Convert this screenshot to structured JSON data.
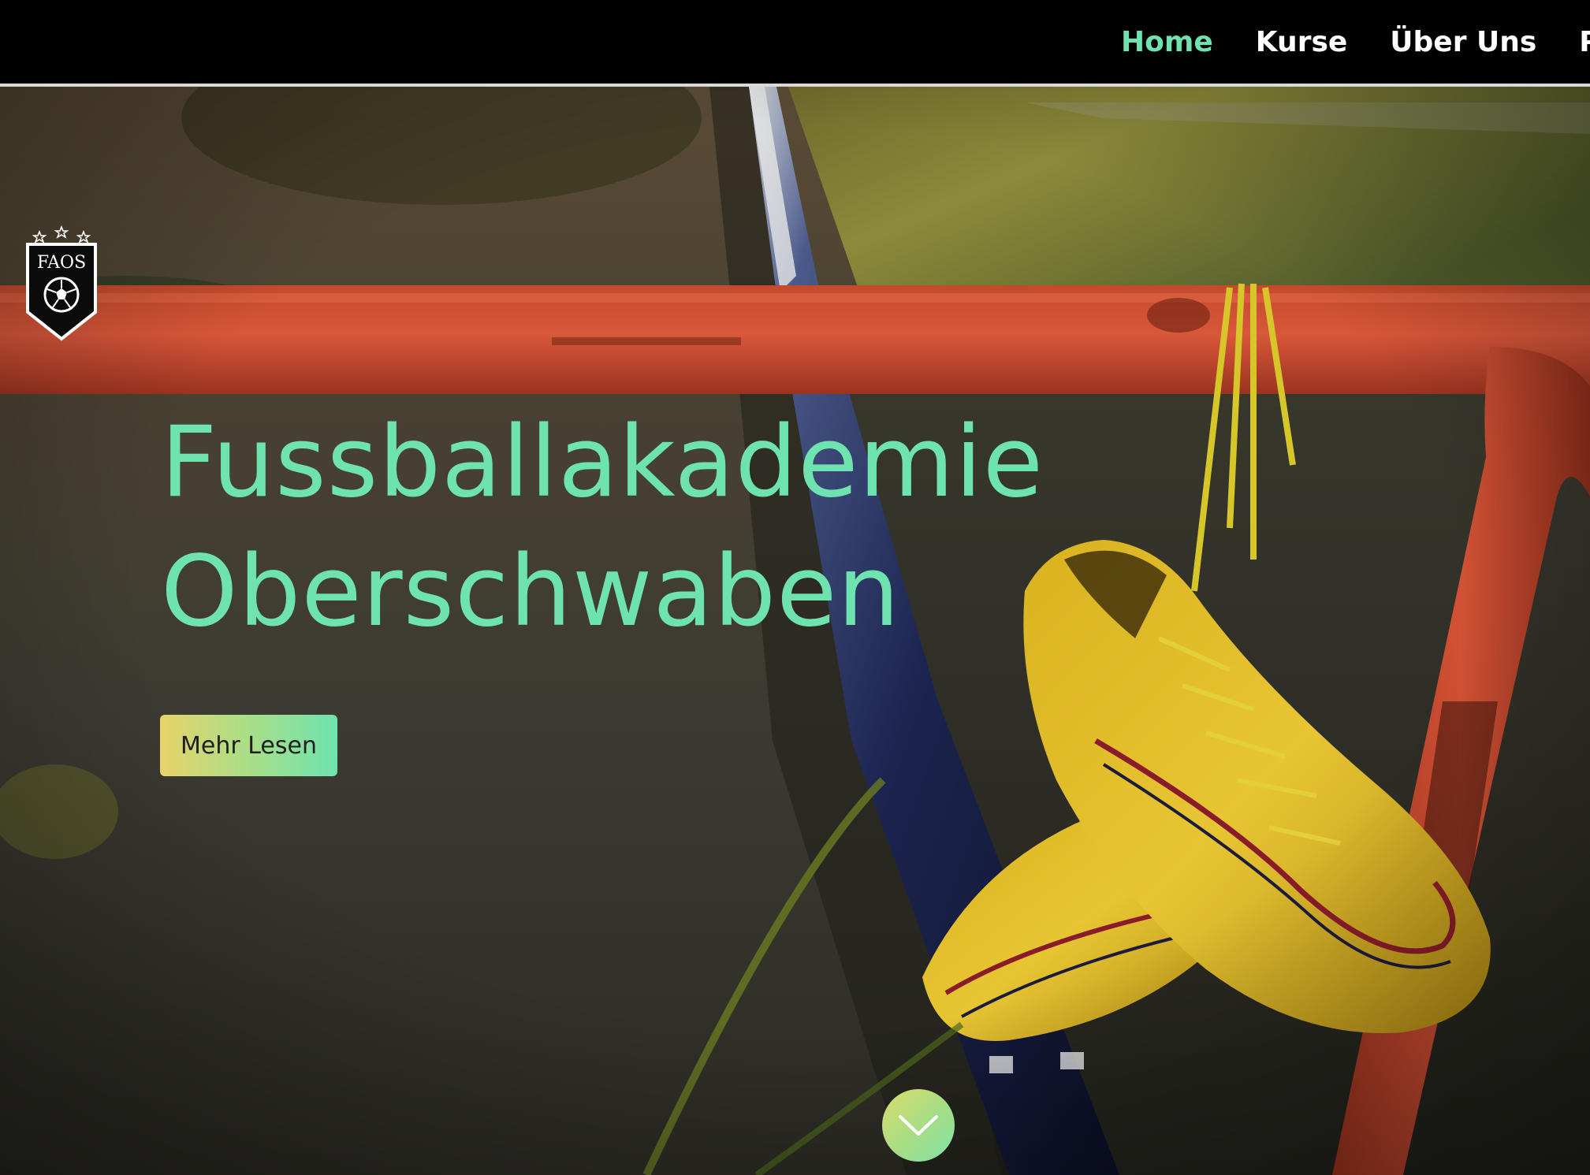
{
  "nav": {
    "items": [
      {
        "label": "Home",
        "active": true
      },
      {
        "label": "Kurse",
        "active": false
      },
      {
        "label": "Über Uns",
        "active": false
      },
      {
        "label": "Pro",
        "active": false
      }
    ]
  },
  "logo": {
    "text": "FAOS",
    "icon": "shield-soccer-ball-logo"
  },
  "hero": {
    "title_line1": "Fussballakademie",
    "title_line2": "Oberschwaben",
    "cta_label": "Mehr Lesen",
    "scroll_icon": "chevron-down-icon"
  },
  "colors": {
    "accent": "#6ee3b0",
    "cta_gradient_start": "#e8d36a",
    "cta_gradient_end": "#6ee3b0",
    "nav_background": "#000000",
    "nav_text": "#ffffff"
  }
}
